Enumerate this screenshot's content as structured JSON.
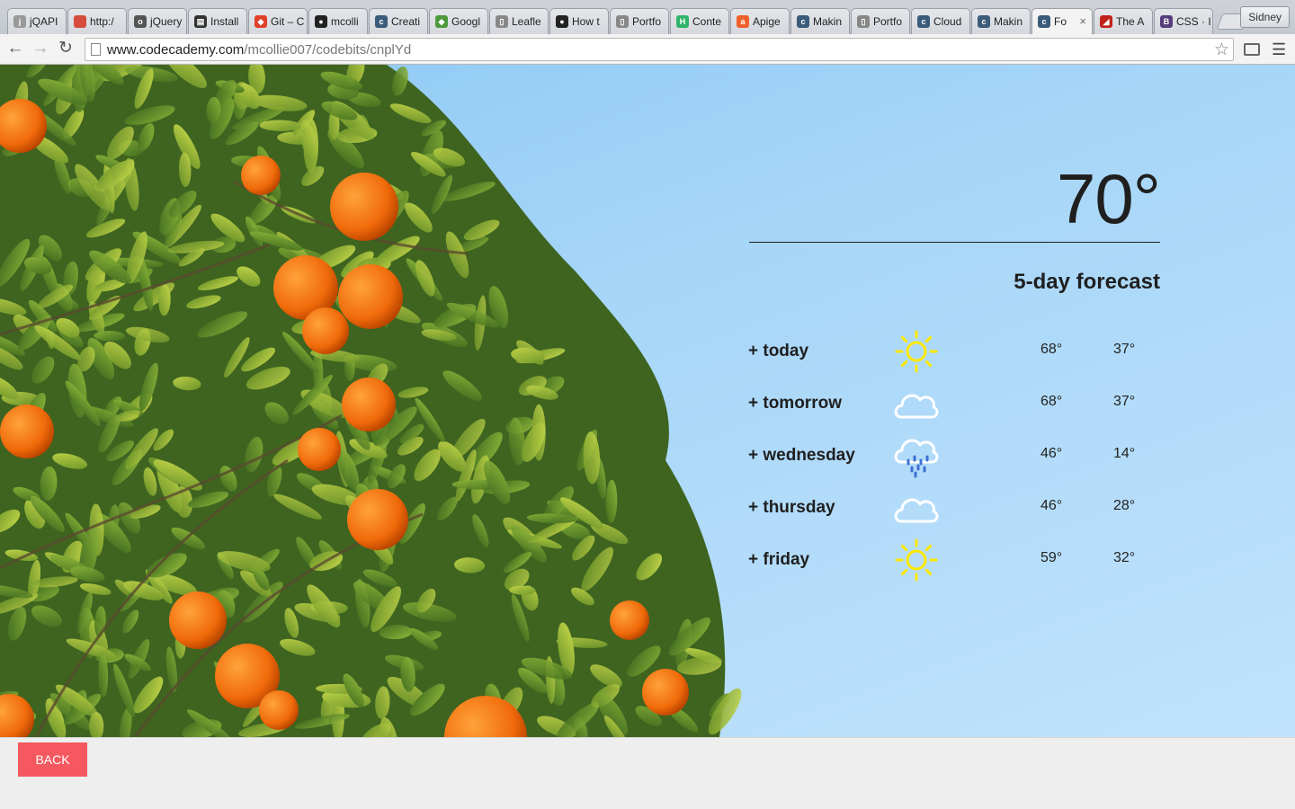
{
  "browser": {
    "tabs": [
      {
        "label": "jQAPI",
        "color": "#999999",
        "glyph": "j"
      },
      {
        "label": "http:/",
        "color": "#d64b3c",
        "glyph": ""
      },
      {
        "label": "jQuery",
        "color": "#555555",
        "glyph": "o"
      },
      {
        "label": "Install",
        "color": "#333333",
        "glyph": "▤"
      },
      {
        "label": "Git – C",
        "color": "#e0402a",
        "glyph": "◆"
      },
      {
        "label": "mcolli",
        "color": "#222222",
        "glyph": "●"
      },
      {
        "label": "Creati",
        "color": "#3b5b7a",
        "glyph": "c"
      },
      {
        "label": "Googl",
        "color": "#4c9a3c",
        "glyph": "◆"
      },
      {
        "label": "Leafle",
        "color": "#888888",
        "glyph": "▯"
      },
      {
        "label": "How t",
        "color": "#222222",
        "glyph": "●"
      },
      {
        "label": "Portfo",
        "color": "#888888",
        "glyph": "▯"
      },
      {
        "label": "Conte",
        "color": "#2fb36b",
        "glyph": "H"
      },
      {
        "label": "Apige",
        "color": "#f0602a",
        "glyph": "a"
      },
      {
        "label": "Makin",
        "color": "#3b5b7a",
        "glyph": "c"
      },
      {
        "label": "Portfo",
        "color": "#888888",
        "glyph": "▯"
      },
      {
        "label": "Cloud",
        "color": "#3b5b7a",
        "glyph": "c"
      },
      {
        "label": "Makin",
        "color": "#3b5b7a",
        "glyph": "c"
      },
      {
        "label": "Fo",
        "color": "#3b5b7a",
        "glyph": "c",
        "active": true
      },
      {
        "label": "The A",
        "color": "#c0221a",
        "glyph": "◢"
      },
      {
        "label": "CSS · I",
        "color": "#563d7c",
        "glyph": "B"
      }
    ],
    "profile_name": "Sidney",
    "url_host": "www.codecademy.com",
    "url_path": "/mcollie007/codebits/cnplYd",
    "icons": {
      "back": "back-arrow-icon",
      "forward": "forward-arrow-icon",
      "reload": "reload-icon",
      "star": "bookmark-star-icon",
      "cast": "cast-icon",
      "menu": "hamburger-menu-icon"
    }
  },
  "weather": {
    "current_temp": "70°",
    "forecast_title": "5-day forecast",
    "days": [
      {
        "day": "+ today",
        "icon": "sun",
        "hi": "68°",
        "lo": "37°"
      },
      {
        "day": "+ tomorrow",
        "icon": "cloud",
        "hi": "68°",
        "lo": "37°"
      },
      {
        "day": "+ wednesday",
        "icon": "rain",
        "hi": "46°",
        "lo": "14°"
      },
      {
        "day": "+ thursday",
        "icon": "cloud",
        "hi": "46°",
        "lo": "28°"
      },
      {
        "day": "+ friday",
        "icon": "sun",
        "hi": "59°",
        "lo": "32°"
      }
    ],
    "colors": {
      "sun": "#ffe900",
      "cloud_stroke": "#ffffff",
      "rain_drops": "#3d6fd6"
    }
  },
  "footer": {
    "back_label": "BACK",
    "back_color": "#f5585e"
  }
}
